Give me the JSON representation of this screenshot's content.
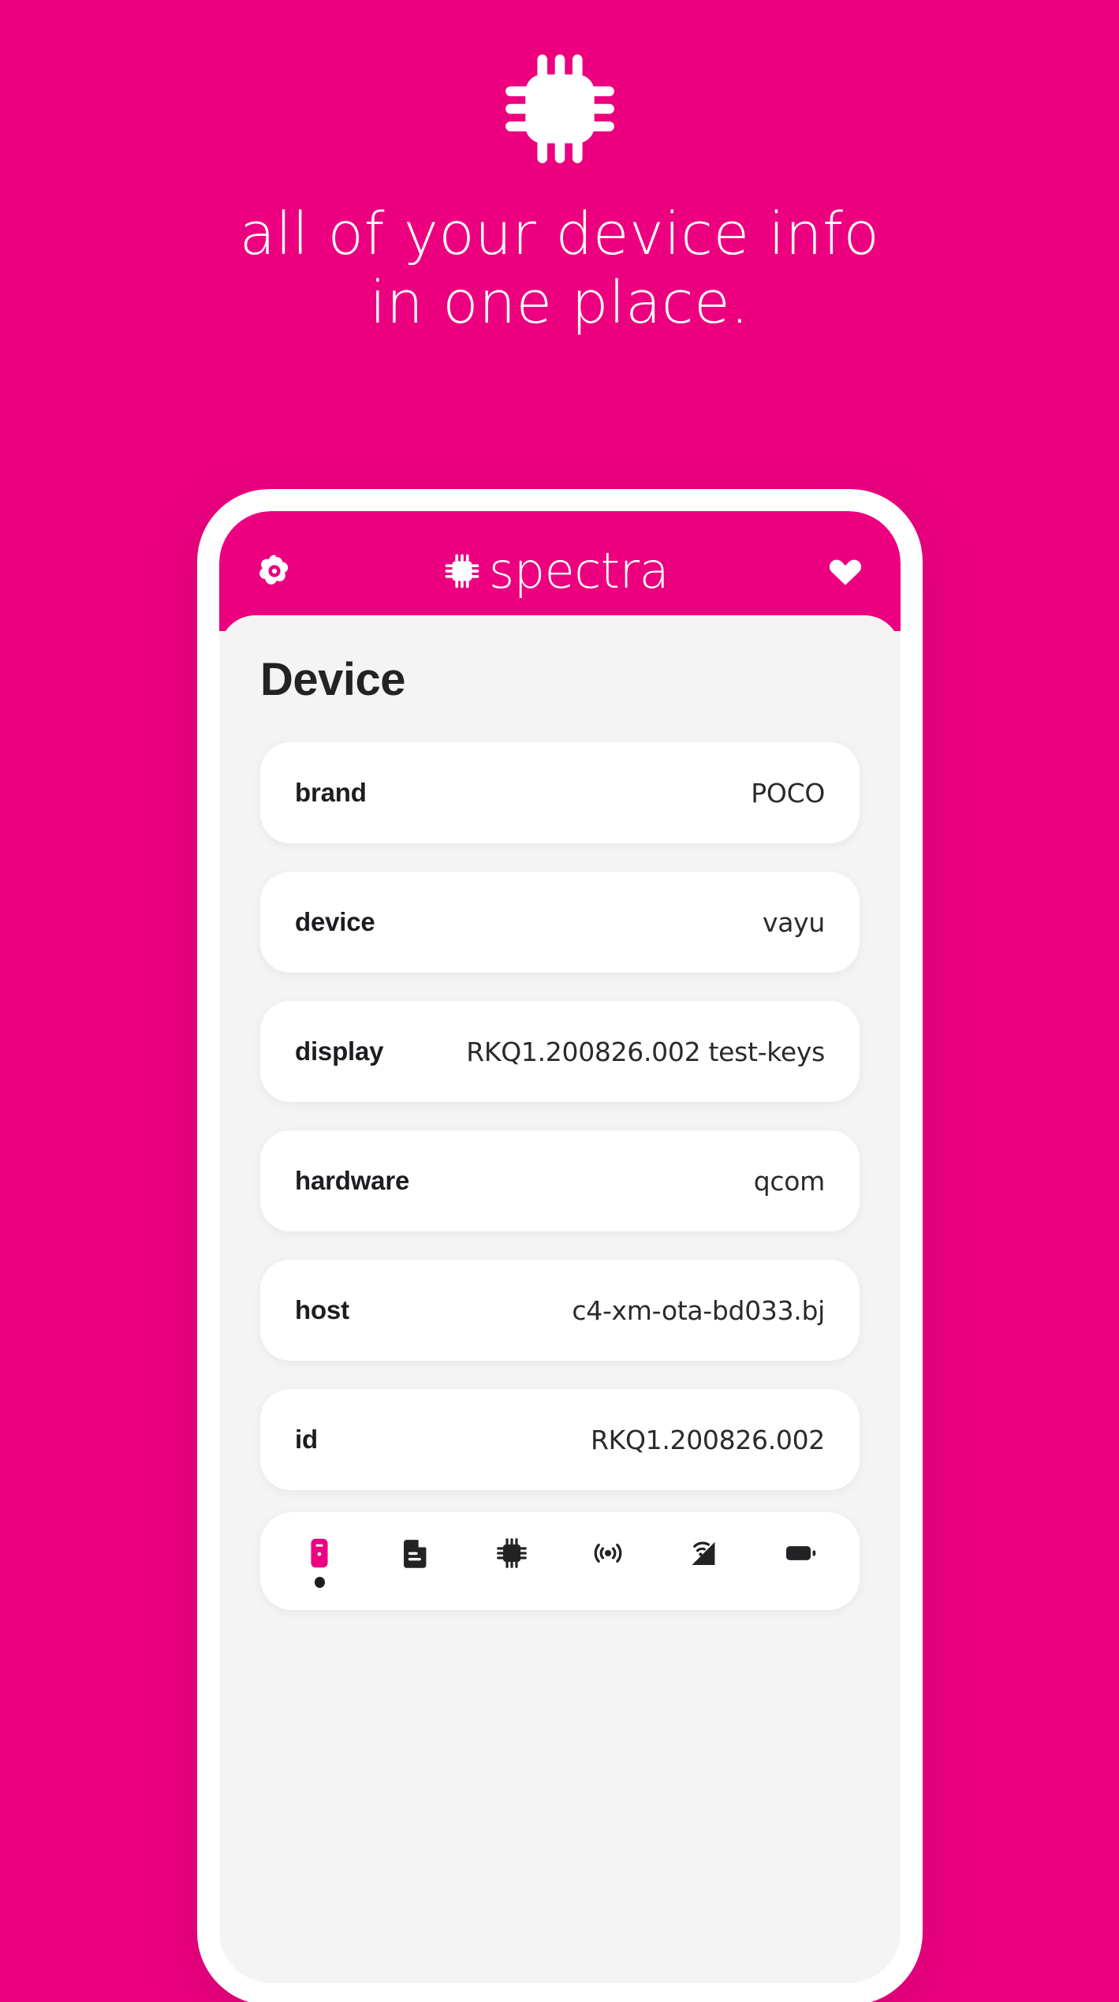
{
  "theme": {
    "background_pink": "#EC0080",
    "accent_pink": "#EC0080",
    "card_white": "#FFFFFF",
    "screen_grey": "#F4F4F5",
    "text_dark": "#1D1D21"
  },
  "hero": {
    "icon": "chip-icon",
    "headline_line1": "all of your device info",
    "headline_line2": "in one place."
  },
  "app_bar": {
    "settings_icon": "gear-icon",
    "brand_icon": "chip-icon",
    "brand_title": "spectra",
    "favorite_icon": "heart-icon"
  },
  "screen": {
    "page_title": "Device",
    "rows": [
      {
        "label": "brand",
        "value": "POCO"
      },
      {
        "label": "device",
        "value": "vayu"
      },
      {
        "label": "display",
        "value": "RKQ1.200826.002 test-keys"
      },
      {
        "label": "hardware",
        "value": "qcom"
      },
      {
        "label": "host",
        "value": "c4-xm-ota-bd033.bj"
      },
      {
        "label": "id",
        "value": "RKQ1.200826.002"
      }
    ]
  },
  "bottom_nav": {
    "items": [
      {
        "name": "device",
        "icon": "phone-icon",
        "active": true
      },
      {
        "name": "system",
        "icon": "file-icon",
        "active": false
      },
      {
        "name": "cpu",
        "icon": "chip-icon",
        "active": false
      },
      {
        "name": "sensors",
        "icon": "sensor-icon",
        "active": false
      },
      {
        "name": "network",
        "icon": "network-icon",
        "active": false
      },
      {
        "name": "battery",
        "icon": "battery-icon",
        "active": false
      }
    ]
  }
}
